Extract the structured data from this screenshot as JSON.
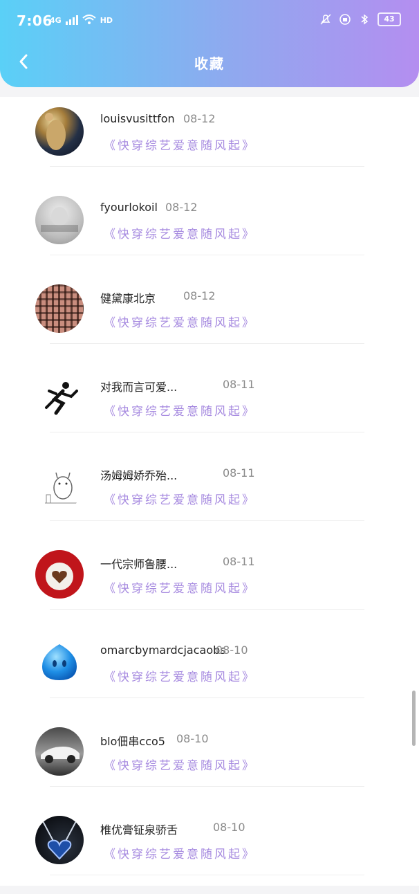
{
  "status_bar": {
    "time": "7:06",
    "network_label": "4G",
    "hd_label": "HD",
    "battery": "43"
  },
  "header": {
    "back_icon": "back-chevron-icon",
    "title": "收藏"
  },
  "items": [
    {
      "name": "louisvusittfon",
      "date": "08-12",
      "subtitle": "《快穿综艺爱意随风起》"
    },
    {
      "name": "fyourlokoil",
      "date": "08-12",
      "subtitle": "《快穿综艺爱意随风起》"
    },
    {
      "name": "健黛康北京",
      "date": "08-12",
      "subtitle": "《快穿综艺爱意随风起》"
    },
    {
      "name": "对我而言可爱...",
      "date": "08-11",
      "subtitle": "《快穿综艺爱意随风起》"
    },
    {
      "name": "汤姆姆娇乔殆...",
      "date": "08-11",
      "subtitle": "《快穿综艺爱意随风起》"
    },
    {
      "name": "一代宗师鲁腰...",
      "date": "08-11",
      "subtitle": "《快穿综艺爱意随风起》"
    },
    {
      "name": "omarcbymardcjacaobs",
      "date": "08-10",
      "subtitle": "《快穿综艺爱意随风起》"
    },
    {
      "name": "blo佃串cco5",
      "date": "08-10",
      "subtitle": "《快穿综艺爱意随风起》"
    },
    {
      "name": "椎优膏钲泉骄舌",
      "date": "08-10",
      "subtitle": "《快穿综艺爱意随风起》"
    }
  ]
}
